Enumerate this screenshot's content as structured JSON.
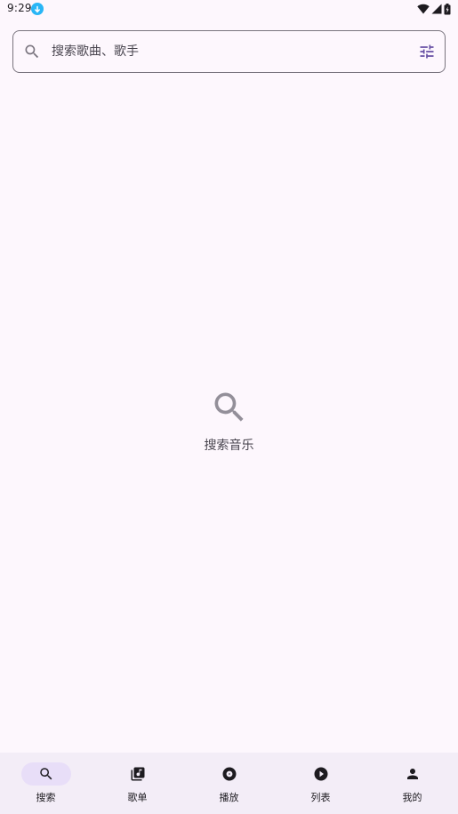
{
  "status_bar": {
    "time": "9:29"
  },
  "search": {
    "placeholder": "搜索歌曲、歌手",
    "value": ""
  },
  "empty_state": {
    "text": "搜索音乐"
  },
  "bottom_nav": {
    "items": [
      {
        "label": "搜索",
        "icon": "search-icon",
        "active": true
      },
      {
        "label": "歌单",
        "icon": "library-music-icon",
        "active": false
      },
      {
        "label": "播放",
        "icon": "album-icon",
        "active": false
      },
      {
        "label": "列表",
        "icon": "play-circle-icon",
        "active": false
      },
      {
        "label": "我的",
        "icon": "person-icon",
        "active": false
      }
    ]
  },
  "colors": {
    "background": "#fdf7fd",
    "nav_background": "#f3edf7",
    "nav_active_pill": "#e8def8",
    "accent": "#6750a4",
    "notification": "#29b6f6"
  }
}
